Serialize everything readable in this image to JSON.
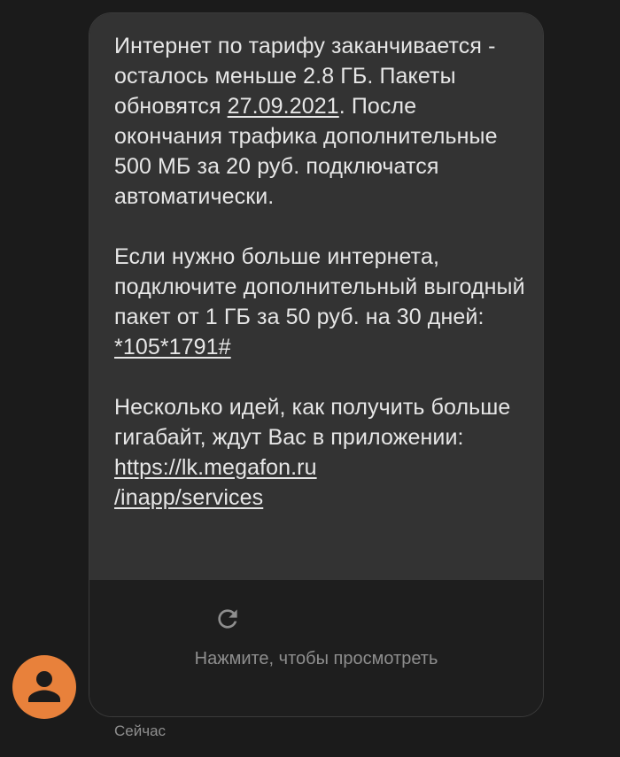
{
  "message": {
    "p1_before_date": "Интернет по тарифу заканчивается - осталось меньше 2.8 ГБ. Пакеты обновятся ",
    "p1_date": "27.09.2021",
    "p1_after_date": ". После окончания трафика дополнительные 500 МБ за 20 руб. подключатся автоматически.",
    "p2_before_code": "Если нужно больше интернета, подключите дополнительный выгодный пакет от 1 ГБ за 50 руб. на 30 дней: ",
    "p2_code": "*105*1791#",
    "p3_before_link": "Несколько идей, как получить больше гигабайт, ждут Вас в приложении: ",
    "p3_link_line1": "https://lk.megafon.ru",
    "p3_link_line2": "/inapp/services"
  },
  "preview": {
    "icon": "reload-icon",
    "label": "Нажмите, чтобы просмотреть"
  },
  "avatar": {
    "icon": "person-icon",
    "color": "#e8813b"
  },
  "timestamp": "Сейчас",
  "colors": {
    "background": "#1b1b1b",
    "bubble": "#333333",
    "text": "#e6e6e6",
    "muted": "#8e8e8e"
  }
}
